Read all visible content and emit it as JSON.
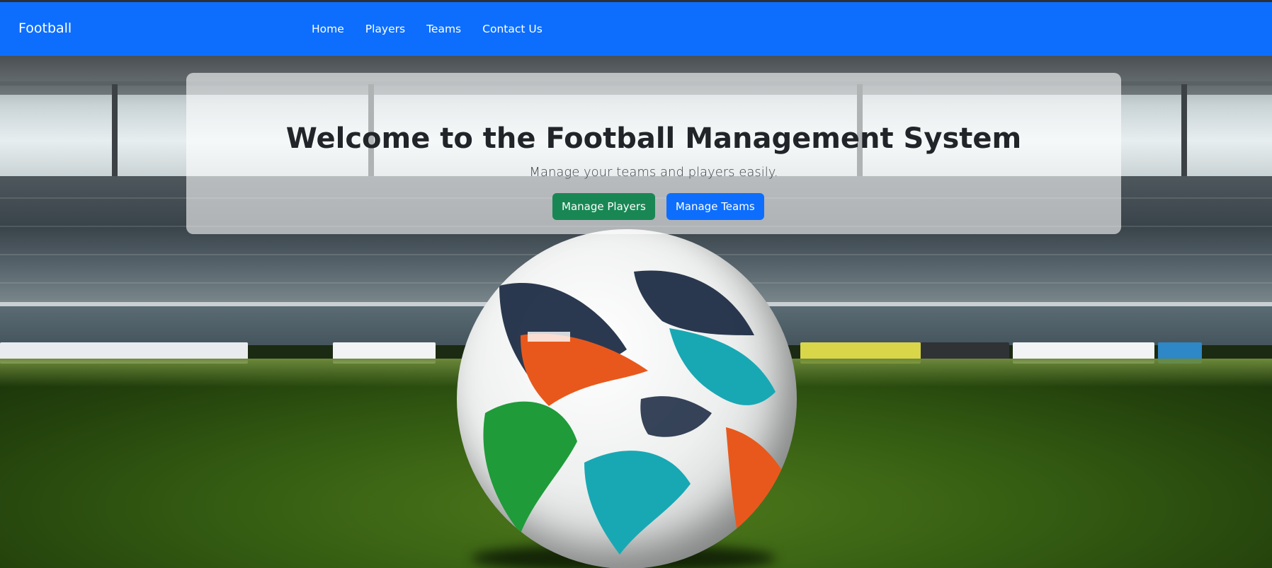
{
  "navbar": {
    "brand": "Football",
    "links": [
      {
        "label": "Home"
      },
      {
        "label": "Players"
      },
      {
        "label": "Teams"
      },
      {
        "label": "Contact Us"
      }
    ]
  },
  "hero": {
    "title": "Welcome to the Football Management System",
    "subtitle": "Manage your teams and players easily.",
    "buttons": {
      "players": "Manage Players",
      "teams": "Manage Teams"
    }
  },
  "background": {
    "description": "stadium-with-football-on-grass"
  },
  "colors": {
    "navbar": "#0d6efd",
    "success": "#198754",
    "primary": "#0d6efd"
  }
}
